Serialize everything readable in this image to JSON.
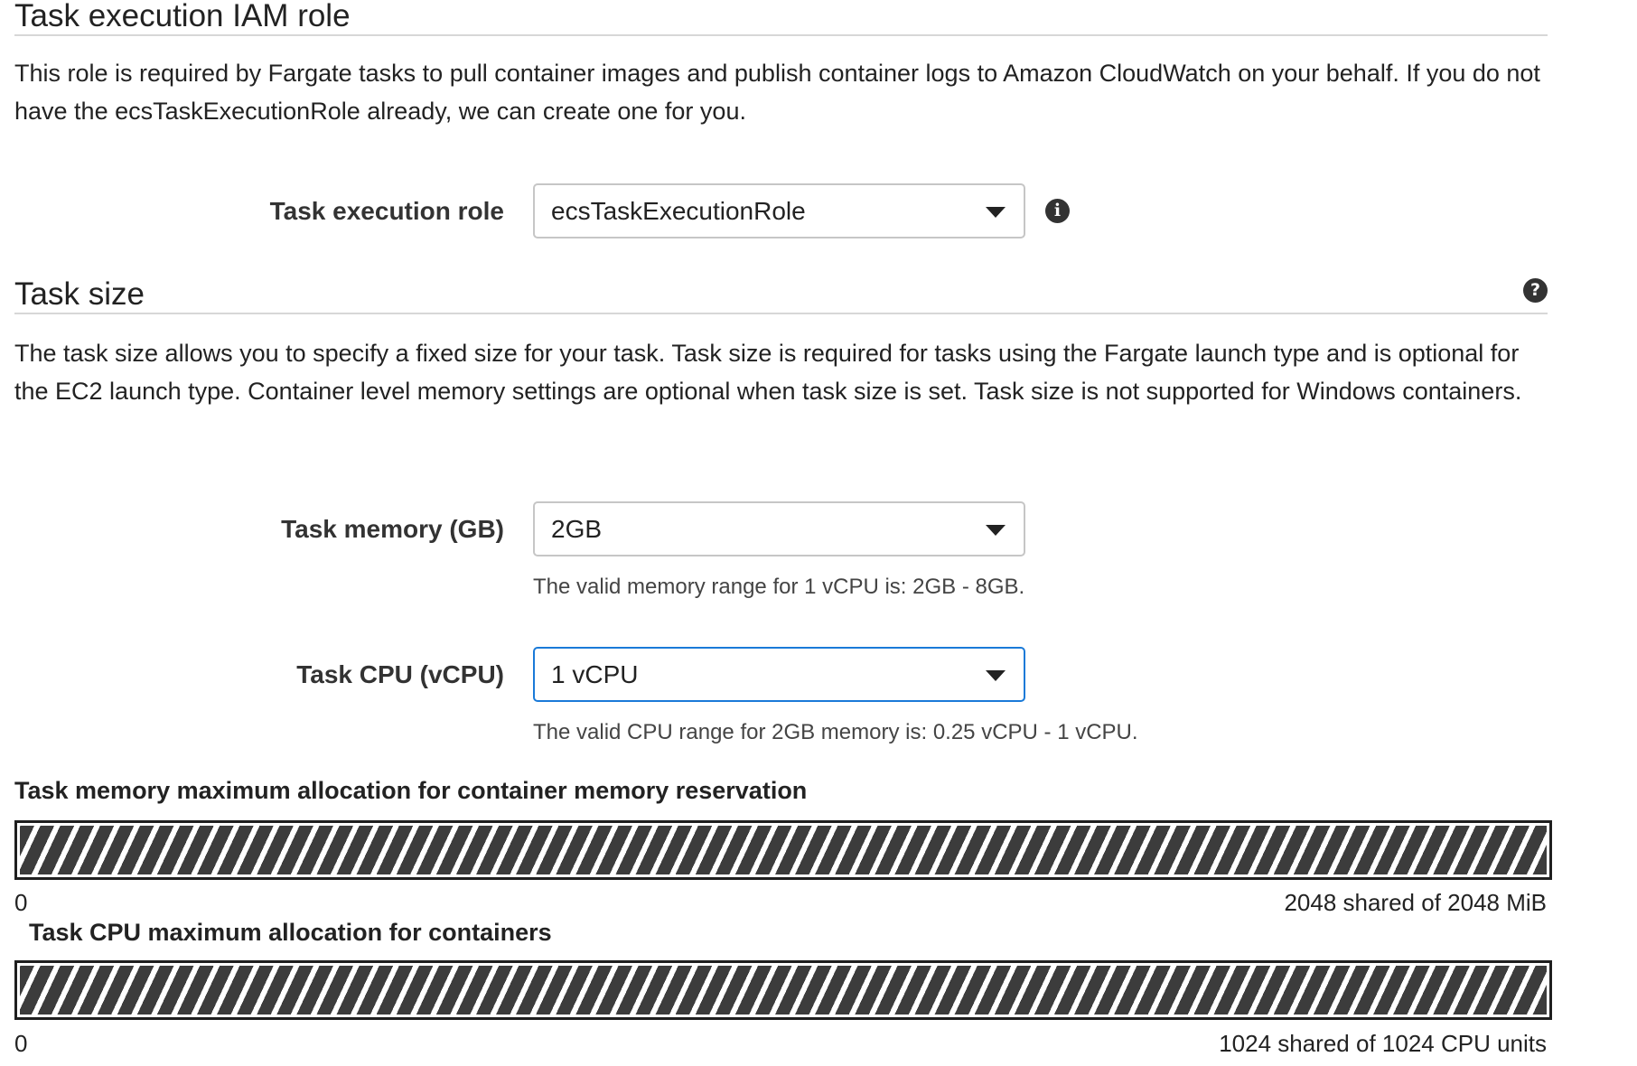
{
  "execution_role_section": {
    "title": "Task execution IAM role",
    "description": "This role is required by Fargate tasks to pull container images and publish container logs to Amazon CloudWatch on your behalf. If you do not have the ecsTaskExecutionRole already, we can create one for you.",
    "role_label": "Task execution role",
    "role_value": "ecsTaskExecutionRole",
    "info_icon": "info-icon"
  },
  "task_size_section": {
    "title": "Task size",
    "help_icon": "help-icon",
    "description": "The task size allows you to specify a fixed size for your task. Task size is required for tasks using the Fargate launch type and is optional for the EC2 launch type. Container level memory settings are optional when task size is set. Task size is not supported for Windows containers.",
    "memory_label": "Task memory (GB)",
    "memory_value": "2GB",
    "memory_hint": "The valid memory range for 1 vCPU is: 2GB - 8GB.",
    "cpu_label": "Task CPU (vCPU)",
    "cpu_value": "1 vCPU",
    "cpu_hint": "The valid CPU range for 2GB memory is: 0.25 vCPU - 1 vCPU."
  },
  "memory_allocation": {
    "title": "Task memory maximum allocation for container memory reservation",
    "min_label": "0",
    "max_label": "2048 shared of 2048 MiB",
    "allocated_fraction": 1.0
  },
  "cpu_allocation": {
    "title": "Task CPU maximum allocation for containers",
    "min_label": "0",
    "max_label": "1024 shared of 1024 CPU units",
    "allocated_fraction": 1.0
  },
  "colors": {
    "focus_border": "#1a7ad8",
    "bar_stripe": "#3c3c3c"
  }
}
